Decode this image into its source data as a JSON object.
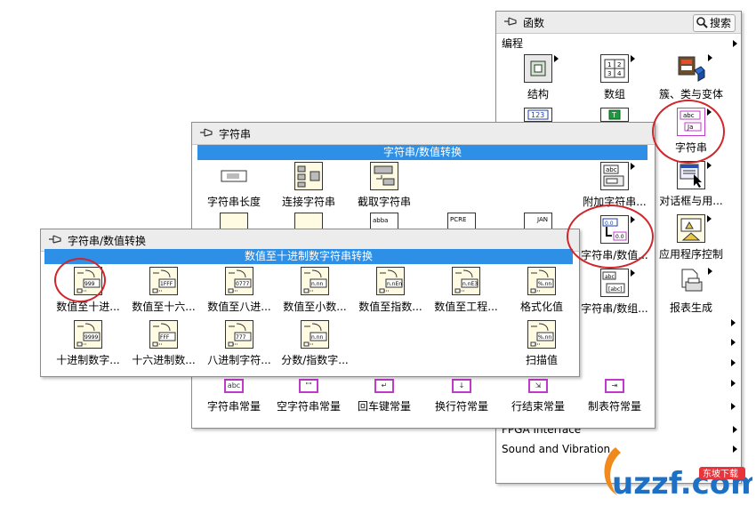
{
  "functions_palette": {
    "title": "函数",
    "search_label": "搜索",
    "category": "编程",
    "icons": [
      {
        "label": "结构",
        "icon": "structures-icon"
      },
      {
        "label": "数组",
        "icon": "array-icon"
      },
      {
        "label": "簇、类与变体",
        "icon": "cluster-class-variant-icon"
      },
      {
        "label": "字符串",
        "icon": "string-icon"
      },
      {
        "label": "对话框与用...",
        "icon": "dialog-user-interface-icon"
      },
      {
        "label": "应用程序控制",
        "icon": "application-control-icon"
      },
      {
        "label": "报表生成",
        "icon": "report-generation-icon"
      }
    ],
    "bottom_items": [
      "FPGA Interface",
      "Sound and Vibration"
    ]
  },
  "string_palette": {
    "title": "字符串",
    "section": "字符串/数值转换",
    "row1": [
      {
        "label": "字符串长度",
        "icon": "string-length-icon"
      },
      {
        "label": "连接字符串",
        "icon": "concatenate-strings-icon"
      },
      {
        "label": "截取字符串",
        "icon": "string-subset-icon"
      },
      {
        "label": "附加字符串...",
        "icon": "append-string-icon"
      }
    ],
    "right_col": [
      {
        "label": "字符串/数值...",
        "icon": "string-number-conversion-icon"
      },
      {
        "label": "字符串/数组...",
        "icon": "string-array-conversion-icon"
      }
    ],
    "constants": [
      {
        "label": "字符串常量",
        "glyph": "abc"
      },
      {
        "label": "空字符串常量",
        "glyph": "\"\""
      },
      {
        "label": "回车键常量",
        "glyph": "↵"
      },
      {
        "label": "换行符常量",
        "glyph": "↓"
      },
      {
        "label": "行结束常量",
        "glyph": "⇲"
      },
      {
        "label": "制表符常量",
        "glyph": "⇥"
      }
    ]
  },
  "conversion_palette": {
    "title": "字符串/数值转换",
    "section": "数值至十进制数字符串转换",
    "row1": [
      {
        "label": "数值至十进...",
        "glyph": "999",
        "icon": "number-to-decimal-string-icon"
      },
      {
        "label": "数值至十六...",
        "glyph": "1FFF",
        "icon": "number-to-hex-string-icon"
      },
      {
        "label": "数值至八进...",
        "glyph": "0777",
        "icon": "number-to-octal-string-icon"
      },
      {
        "label": "数值至小数...",
        "glyph": "n.nn",
        "icon": "number-to-fractional-string-icon"
      },
      {
        "label": "数值至指数...",
        "glyph": "n.nEn",
        "icon": "number-to-exponential-string-icon"
      },
      {
        "label": "数值至工程...",
        "glyph": "n.nE3",
        "icon": "number-to-engineering-string-icon"
      },
      {
        "label": "格式化值",
        "glyph": "%.nn",
        "icon": "format-value-icon"
      }
    ],
    "row2": [
      {
        "label": "十进制数字...",
        "glyph": "9999",
        "icon": "decimal-string-to-number-icon"
      },
      {
        "label": "十六进制数...",
        "glyph": "FFF",
        "icon": "hex-string-to-number-icon"
      },
      {
        "label": "八进制字符...",
        "glyph": "777",
        "icon": "octal-string-to-number-icon"
      },
      {
        "label": "分数/指数字...",
        "glyph": "n.nn",
        "icon": "fract-exp-string-to-number-icon"
      },
      {
        "label": "扫描值",
        "glyph": "%.nn",
        "icon": "scan-value-icon"
      }
    ]
  },
  "watermark": {
    "text": "uzzf.com",
    "subtext": "东坡下载"
  }
}
